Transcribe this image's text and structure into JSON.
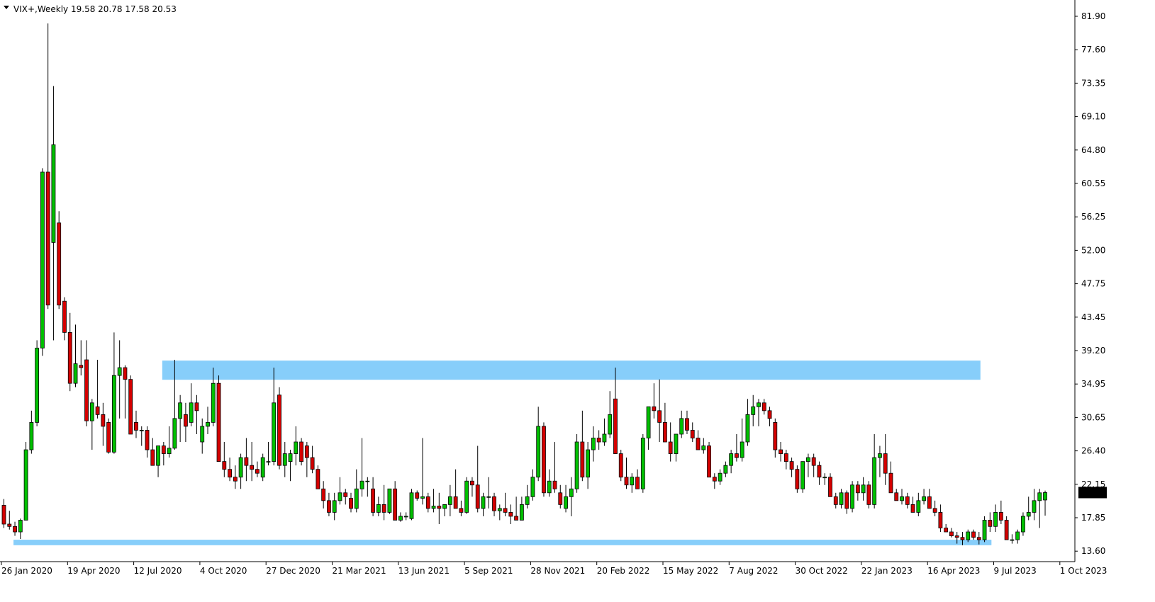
{
  "header": {
    "symbol": "VIX+,Weekly",
    "ohlc": "19.58 20.78 17.58 20.53"
  },
  "colors": {
    "up": "#00c000",
    "down": "#d40000",
    "wick": "#000000",
    "zone": "#87cefa",
    "axis": "#000000",
    "background": "#ffffff",
    "price_label_bg": "#000000",
    "price_label_text": "#ffffff"
  },
  "price_label": "20.53",
  "chart_data": {
    "type": "candlestick",
    "symbol": "VIX+",
    "timeframe": "Weekly",
    "ylim": [
      11.7,
      83.5
    ],
    "y_ticks": [
      "81.90",
      "77.60",
      "73.35",
      "69.10",
      "64.80",
      "60.55",
      "56.25",
      "52.00",
      "47.75",
      "43.45",
      "39.20",
      "34.95",
      "30.65",
      "26.40",
      "22.15",
      "17.85",
      "13.60"
    ],
    "x_ticks": [
      "26 Jan 2020",
      "19 Apr 2020",
      "12 Jul 2020",
      "4 Oct 2020",
      "27 Dec 2020",
      "21 Mar 2021",
      "13 Jun 2021",
      "5 Sep 2021",
      "28 Nov 2021",
      "20 Feb 2022",
      "15 May 2022",
      "7 Aug 2022",
      "30 Oct 2022",
      "22 Jan 2023",
      "16 Apr 2023",
      "9 Jul 2023",
      "1 Oct 2023"
    ],
    "last_price": 20.53,
    "zones": [
      {
        "name": "resistance",
        "from": 34.95,
        "to": 37.4,
        "start_week": 29,
        "end_week": 177
      },
      {
        "name": "support",
        "from": 13.8,
        "to": 14.5,
        "start_week": 2,
        "end_week": 179
      }
    ],
    "candles": [
      [
        18.9,
        19.7,
        16.0,
        16.5
      ],
      [
        16.5,
        18.2,
        15.8,
        16.2
      ],
      [
        16.2,
        16.8,
        15.0,
        15.5
      ],
      [
        15.5,
        17.2,
        14.6,
        17.0
      ],
      [
        17.0,
        27.0,
        17.0,
        26.0
      ],
      [
        26.0,
        31.0,
        25.5,
        29.5
      ],
      [
        29.5,
        40.0,
        29.0,
        39.0
      ],
      [
        39.0,
        62.0,
        38.0,
        61.5
      ],
      [
        61.5,
        80.5,
        44.0,
        44.5
      ],
      [
        52.5,
        72.5,
        40.0,
        65.0
      ],
      [
        55.0,
        56.5,
        44.0,
        44.5
      ],
      [
        45.0,
        45.5,
        40.0,
        41.0
      ],
      [
        41.0,
        43.5,
        33.5,
        34.5
      ],
      [
        34.5,
        42.0,
        34.0,
        37.0
      ],
      [
        36.8,
        40.0,
        35.5,
        36.5
      ],
      [
        37.5,
        40.0,
        29.0,
        29.7
      ],
      [
        29.7,
        32.5,
        26.0,
        32.0
      ],
      [
        31.5,
        37.5,
        30.0,
        30.5
      ],
      [
        30.5,
        32.0,
        26.5,
        29.0
      ],
      [
        29.5,
        30.0,
        25.5,
        25.7
      ],
      [
        25.7,
        41.0,
        25.5,
        35.5
      ],
      [
        35.5,
        40.0,
        30.0,
        36.5
      ],
      [
        36.5,
        36.8,
        30.0,
        35.0
      ],
      [
        35.0,
        35.5,
        29.0,
        28.0
      ],
      [
        29.5,
        31.0,
        27.5,
        28.5
      ],
      [
        28.5,
        29.0,
        26.5,
        28.5
      ],
      [
        28.5,
        29.0,
        25.0,
        26.0
      ],
      [
        26.0,
        27.5,
        24.5,
        24.0
      ],
      [
        24.0,
        26.5,
        22.5,
        26.5
      ],
      [
        26.5,
        27.0,
        24.0,
        25.5
      ],
      [
        25.5,
        29.0,
        25.0,
        26.2
      ],
      [
        26.2,
        37.5,
        26.0,
        30.0
      ],
      [
        30.0,
        33.0,
        27.0,
        32.0
      ],
      [
        30.5,
        32.0,
        27.0,
        29.0
      ],
      [
        29.5,
        34.5,
        29.0,
        32.0
      ],
      [
        32.0,
        33.0,
        28.0,
        31.0
      ],
      [
        27.0,
        30.0,
        25.5,
        29.0
      ],
      [
        29.0,
        31.5,
        28.0,
        29.5
      ],
      [
        29.5,
        36.5,
        29.0,
        34.5
      ],
      [
        34.5,
        35.5,
        24.5,
        24.5
      ],
      [
        24.5,
        27.0,
        22.5,
        23.5
      ],
      [
        23.5,
        25.0,
        22.0,
        22.5
      ],
      [
        22.5,
        24.0,
        21.0,
        22.0
      ],
      [
        22.5,
        25.5,
        21.0,
        25.0
      ],
      [
        25.0,
        27.5,
        22.0,
        24.0
      ],
      [
        24.0,
        27.0,
        22.0,
        23.5
      ],
      [
        23.5,
        24.5,
        22.5,
        23.0
      ],
      [
        22.5,
        25.5,
        22.0,
        25.0
      ],
      [
        24.5,
        27.0,
        24.0,
        24.5
      ],
      [
        24.5,
        36.5,
        24.0,
        32.0
      ],
      [
        33.0,
        34.0,
        23.5,
        24.0
      ],
      [
        24.0,
        27.0,
        22.5,
        25.5
      ],
      [
        24.5,
        26.0,
        22.0,
        25.5
      ],
      [
        25.5,
        29.0,
        24.0,
        27.0
      ],
      [
        27.0,
        27.5,
        24.0,
        24.5
      ],
      [
        26.5,
        27.0,
        22.5,
        25.0
      ],
      [
        25.0,
        26.5,
        23.0,
        23.5
      ],
      [
        23.5,
        24.0,
        21.0,
        21.0
      ],
      [
        21.0,
        22.0,
        18.5,
        19.5
      ],
      [
        19.5,
        20.5,
        17.5,
        18.0
      ],
      [
        18.0,
        20.5,
        17.0,
        19.5
      ],
      [
        19.5,
        22.5,
        19.0,
        20.5
      ],
      [
        20.5,
        21.0,
        19.0,
        20.0
      ],
      [
        19.8,
        20.5,
        18.0,
        18.5
      ],
      [
        18.5,
        23.5,
        18.0,
        21.0
      ],
      [
        21.0,
        27.5,
        20.0,
        22.0
      ],
      [
        22.0,
        22.5,
        20.0,
        22.0
      ],
      [
        21.0,
        22.5,
        17.5,
        18.0
      ],
      [
        18.0,
        20.0,
        17.5,
        19.0
      ],
      [
        19.0,
        21.5,
        17.0,
        18.0
      ],
      [
        18.0,
        21.0,
        17.8,
        21.0
      ],
      [
        21.0,
        22.0,
        17.0,
        17.0
      ],
      [
        17.0,
        18.0,
        16.8,
        17.5
      ],
      [
        17.5,
        18.0,
        17.0,
        17.5
      ],
      [
        17.2,
        21.0,
        17.0,
        20.5
      ],
      [
        20.5,
        20.8,
        19.5,
        19.8
      ],
      [
        19.8,
        27.5,
        19.0,
        20.0
      ],
      [
        20.0,
        20.5,
        18.0,
        18.5
      ],
      [
        18.5,
        21.0,
        18.0,
        18.8
      ],
      [
        18.8,
        20.5,
        16.5,
        18.5
      ],
      [
        18.5,
        19.0,
        17.5,
        19.0
      ],
      [
        19.0,
        21.5,
        17.5,
        20.0
      ],
      [
        20.0,
        23.5,
        19.0,
        18.5
      ],
      [
        18.5,
        19.5,
        17.5,
        18.0
      ],
      [
        18.0,
        22.5,
        17.8,
        22.0
      ],
      [
        22.0,
        22.5,
        20.0,
        21.5
      ],
      [
        21.5,
        26.5,
        18.0,
        18.5
      ],
      [
        18.5,
        20.5,
        17.5,
        20.0
      ],
      [
        20.0,
        22.5,
        18.5,
        20.0
      ],
      [
        20.0,
        20.5,
        17.5,
        18.2
      ],
      [
        18.2,
        19.0,
        17.0,
        18.5
      ],
      [
        18.5,
        20.5,
        17.5,
        18.0
      ],
      [
        18.0,
        19.0,
        16.5,
        17.5
      ],
      [
        17.5,
        20.0,
        17.0,
        17.0
      ],
      [
        17.0,
        20.0,
        17.0,
        19.0
      ],
      [
        19.0,
        21.5,
        18.5,
        20.0
      ],
      [
        20.0,
        23.5,
        19.5,
        22.5
      ],
      [
        22.5,
        31.5,
        22.0,
        29.0
      ],
      [
        29.0,
        29.5,
        20.0,
        20.5
      ],
      [
        20.5,
        23.5,
        20.0,
        22.0
      ],
      [
        22.0,
        27.0,
        20.5,
        21.0
      ],
      [
        20.5,
        21.5,
        18.5,
        19.0
      ],
      [
        18.5,
        21.5,
        18.0,
        20.0
      ],
      [
        20.0,
        22.5,
        17.5,
        21.0
      ],
      [
        21.0,
        28.0,
        20.5,
        27.0
      ],
      [
        27.0,
        31.0,
        22.0,
        22.5
      ],
      [
        22.5,
        27.0,
        21.0,
        26.0
      ],
      [
        26.0,
        29.0,
        24.5,
        27.5
      ],
      [
        27.5,
        28.5,
        26.0,
        27.0
      ],
      [
        27.0,
        30.0,
        26.5,
        28.0
      ],
      [
        28.0,
        33.5,
        27.5,
        30.5
      ],
      [
        32.5,
        36.5,
        25.5,
        25.5
      ],
      [
        25.5,
        26.0,
        22.0,
        22.5
      ],
      [
        22.5,
        25.0,
        21.0,
        21.5
      ],
      [
        21.5,
        23.0,
        20.5,
        22.5
      ],
      [
        22.5,
        23.5,
        21.0,
        21.0
      ],
      [
        21.0,
        28.0,
        20.5,
        27.5
      ],
      [
        27.5,
        29.5,
        26.0,
        31.5
      ],
      [
        31.5,
        34.5,
        30.0,
        31.0
      ],
      [
        31.0,
        35.0,
        27.0,
        29.5
      ],
      [
        29.5,
        32.0,
        27.0,
        27.0
      ],
      [
        27.0,
        29.5,
        24.5,
        25.5
      ],
      [
        25.5,
        28.0,
        24.5,
        28.0
      ],
      [
        28.0,
        31.0,
        27.5,
        30.0
      ],
      [
        30.0,
        31.0,
        28.0,
        28.5
      ],
      [
        28.5,
        29.5,
        27.0,
        27.5
      ],
      [
        27.5,
        28.5,
        26.0,
        26.0
      ],
      [
        26.0,
        27.5,
        25.5,
        26.5
      ],
      [
        26.5,
        27.0,
        22.5,
        22.5
      ],
      [
        22.5,
        23.0,
        21.0,
        22.0
      ],
      [
        22.0,
        23.5,
        21.5,
        23.0
      ],
      [
        23.0,
        24.5,
        22.5,
        24.0
      ],
      [
        24.0,
        26.0,
        23.0,
        25.5
      ],
      [
        25.5,
        28.0,
        24.5,
        25.0
      ],
      [
        25.0,
        30.0,
        24.5,
        27.0
      ],
      [
        27.0,
        32.5,
        26.5,
        30.5
      ],
      [
        30.5,
        33.0,
        29.0,
        31.5
      ],
      [
        31.5,
        32.5,
        29.0,
        32.0
      ],
      [
        32.0,
        32.5,
        30.5,
        31.0
      ],
      [
        31.0,
        31.5,
        29.0,
        30.0
      ],
      [
        29.5,
        30.0,
        25.0,
        26.0
      ],
      [
        26.0,
        27.0,
        24.5,
        25.5
      ],
      [
        25.5,
        26.0,
        23.5,
        24.5
      ],
      [
        24.5,
        25.0,
        22.5,
        23.5
      ],
      [
        23.5,
        24.0,
        20.5,
        21.0
      ],
      [
        21.0,
        23.0,
        20.5,
        24.5
      ],
      [
        24.5,
        25.5,
        22.5,
        25.0
      ],
      [
        25.0,
        25.5,
        22.5,
        24.0
      ],
      [
        24.0,
        24.5,
        21.5,
        22.5
      ],
      [
        22.5,
        23.0,
        21.5,
        22.5
      ],
      [
        22.5,
        23.0,
        20.0,
        20.0
      ],
      [
        20.0,
        20.5,
        18.5,
        19.0
      ],
      [
        19.0,
        21.0,
        18.5,
        20.5
      ],
      [
        20.5,
        20.8,
        17.8,
        18.5
      ],
      [
        18.5,
        22.0,
        18.0,
        21.5
      ],
      [
        21.5,
        22.0,
        19.5,
        20.5
      ],
      [
        20.5,
        22.5,
        19.5,
        21.5
      ],
      [
        21.5,
        22.0,
        18.5,
        19.0
      ],
      [
        19.0,
        28.0,
        18.5,
        25.0
      ],
      [
        25.0,
        26.5,
        22.5,
        25.5
      ],
      [
        25.5,
        28.0,
        21.5,
        23.0
      ],
      [
        23.0,
        24.5,
        20.5,
        20.5
      ],
      [
        20.5,
        21.0,
        19.5,
        19.5
      ],
      [
        19.5,
        21.0,
        19.0,
        20.0
      ],
      [
        20.0,
        20.5,
        18.5,
        19.0
      ],
      [
        19.0,
        20.0,
        18.0,
        18.0
      ],
      [
        18.0,
        20.5,
        17.5,
        19.5
      ],
      [
        19.5,
        21.0,
        19.0,
        20.0
      ],
      [
        20.0,
        21.0,
        18.8,
        18.5
      ],
      [
        18.5,
        19.5,
        17.5,
        18.0
      ],
      [
        18.0,
        19.0,
        15.5,
        16.0
      ],
      [
        16.0,
        16.5,
        15.5,
        15.5
      ],
      [
        15.5,
        16.0,
        14.8,
        15.0
      ],
      [
        15.0,
        15.5,
        14.0,
        14.8
      ],
      [
        14.8,
        15.5,
        13.8,
        14.5
      ],
      [
        14.5,
        15.8,
        14.2,
        15.5
      ],
      [
        15.5,
        15.8,
        14.5,
        14.8
      ],
      [
        14.8,
        15.5,
        13.9,
        14.5
      ],
      [
        14.5,
        17.5,
        14.2,
        17.0
      ],
      [
        17.0,
        18.0,
        15.5,
        16.2
      ],
      [
        16.2,
        19.0,
        15.5,
        18.0
      ],
      [
        18.0,
        19.5,
        16.5,
        17.0
      ],
      [
        17.0,
        17.5,
        14.5,
        14.5
      ],
      [
        14.5,
        15.2,
        14.0,
        14.5
      ],
      [
        14.5,
        15.8,
        14.0,
        15.5
      ],
      [
        15.5,
        18.0,
        15.0,
        17.5
      ],
      [
        17.5,
        20.0,
        17.0,
        18.0
      ],
      [
        18.0,
        21.0,
        17.0,
        19.5
      ],
      [
        19.5,
        21.0,
        16.0,
        20.5
      ],
      [
        19.58,
        20.78,
        17.58,
        20.53
      ]
    ]
  }
}
